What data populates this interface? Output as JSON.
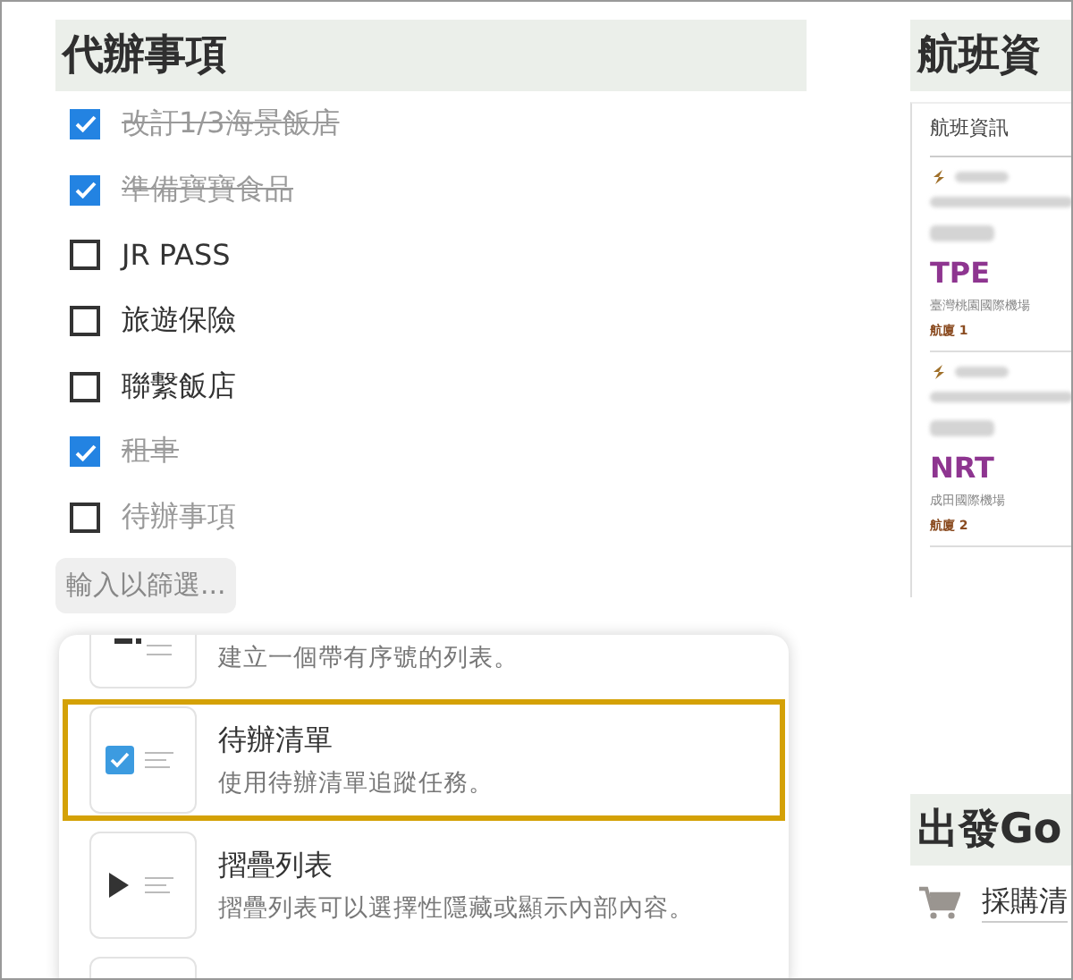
{
  "todo_section": {
    "title": "代辦事項",
    "items": [
      {
        "label": "改訂1/3海景飯店",
        "checked": true
      },
      {
        "label": "準備寶寶食品",
        "checked": true
      },
      {
        "label": "JR PASS",
        "checked": false
      },
      {
        "label": "旅遊保險",
        "checked": false
      },
      {
        "label": "聯繫飯店",
        "checked": false
      },
      {
        "label": "租車",
        "checked": true
      }
    ],
    "new_item": {
      "placeholder": "待辦事項",
      "checked": false
    },
    "filter_placeholder": "輸入以篩選..."
  },
  "flight_section": {
    "title": "航班資",
    "card_title": "航班資訊",
    "segments": [
      {
        "airport_code": "TPE",
        "airport_name": "臺灣桃園國際機場",
        "terminal": "航廈 1"
      },
      {
        "airport_code": "NRT",
        "airport_name": "成田國際機場",
        "terminal": "航廈 2"
      }
    ]
  },
  "departure_section": {
    "title": "出發Go",
    "link": "採購清"
  },
  "block_menu": {
    "items": [
      {
        "kind": "numbered",
        "description": "建立一個帶有序號的列表。",
        "selected": false
      },
      {
        "kind": "todo",
        "title": "待辦清單",
        "description": "使用待辦清單追蹤任務。",
        "selected": true
      },
      {
        "kind": "toggle",
        "title": "摺疊列表",
        "description": "摺疊列表可以選擇性隱藏或顯示內部內容。",
        "selected": false
      },
      {
        "kind": "partial",
        "selected": false
      }
    ]
  }
}
